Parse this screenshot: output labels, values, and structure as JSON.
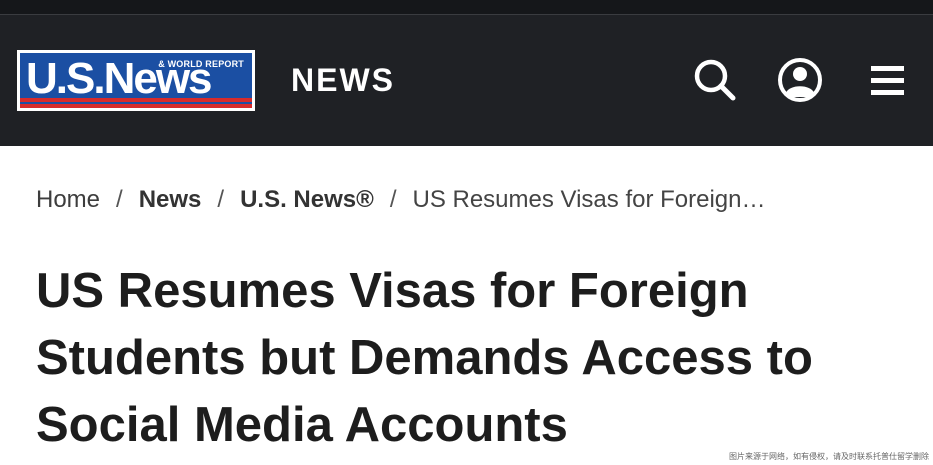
{
  "header": {
    "logo": {
      "main_text": "U.S.News",
      "tagline": "& WORLD REPORT"
    },
    "section_label": "NEWS",
    "icons": {
      "search": "search-icon",
      "account": "account-icon",
      "menu": "menu-icon"
    }
  },
  "breadcrumb": {
    "items": [
      "Home",
      "News",
      "U.S. News®",
      "US Resumes Visas for Foreign…"
    ],
    "separator": "/"
  },
  "article": {
    "headline": "US Resumes Visas for Foreign Students but Demands Access to Social Media Accounts"
  },
  "watermark": "图片来源于网络，如有侵权，请及时联系托普仕留学删除",
  "colors": {
    "header_bg": "#1f2125",
    "logo_blue": "#1b4fa3",
    "logo_red": "#d62b2b",
    "headline": "#1d1d1d"
  }
}
